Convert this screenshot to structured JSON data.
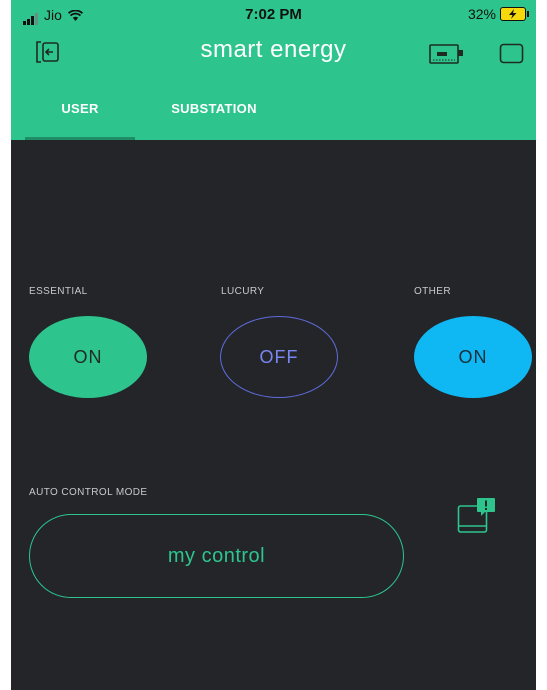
{
  "status_bar": {
    "carrier": "Jio",
    "time": "7:02 PM",
    "battery": "32%"
  },
  "app": {
    "title": "smart energy"
  },
  "tabs": [
    {
      "label": "USER",
      "active": true
    },
    {
      "label": "SUBSTATION",
      "active": false
    }
  ],
  "toggles": [
    {
      "label": "ESSENTIAL",
      "state": "ON",
      "color": "#2dc58d"
    },
    {
      "label": "LUCURY",
      "state": "OFF",
      "color": "#5f6bdb"
    },
    {
      "label": "OTHER",
      "state": "ON",
      "color": "#10b8f3"
    }
  ],
  "auto_control": {
    "label": "AUTO CONTROL MODE",
    "button": "my control"
  },
  "icons": {
    "back": "login-back-icon",
    "device": "device-icon",
    "window": "window-icon",
    "notification": "device-notification-icon"
  },
  "colors": {
    "header": "#2dc58d",
    "background": "#232529",
    "accent_blue": "#10b8f3"
  }
}
